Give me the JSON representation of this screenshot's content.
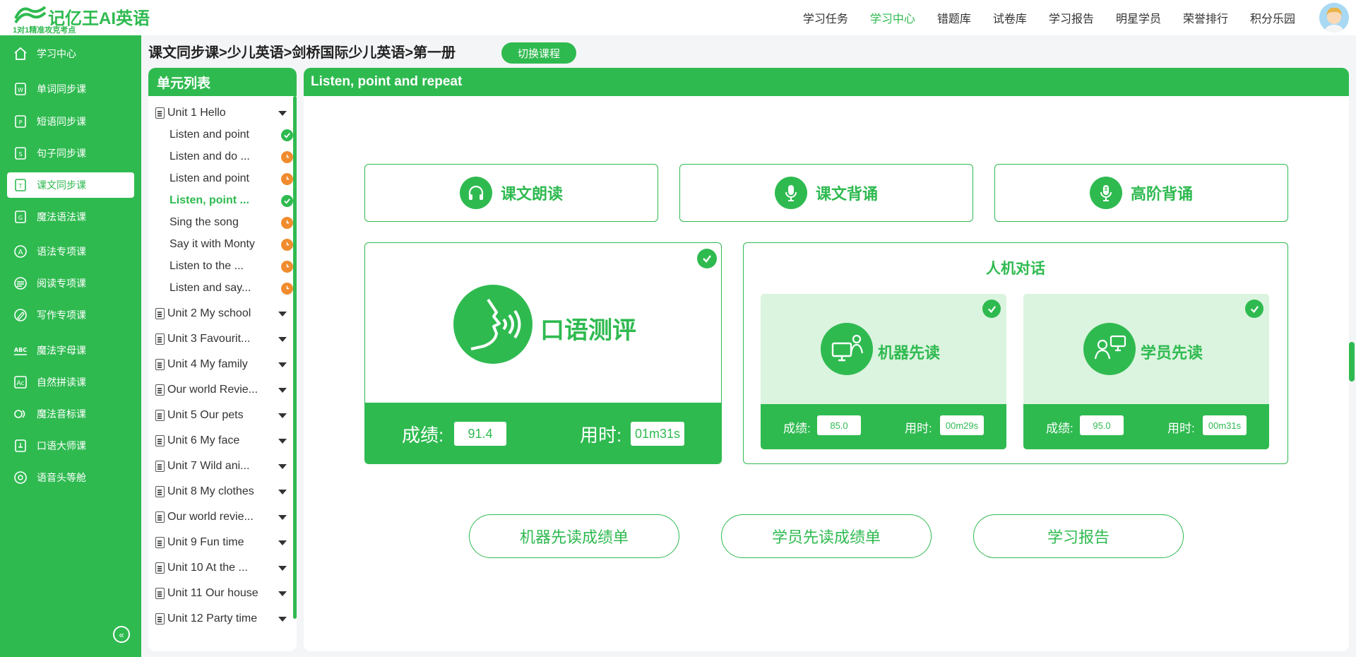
{
  "logo": {
    "name": "记亿王AI英语",
    "slogan": "1对1精准攻克考点"
  },
  "nav": [
    "学习任务",
    "学习中心",
    "错题库",
    "试卷库",
    "学习报告",
    "明星学员",
    "荣誉排行",
    "积分乐园"
  ],
  "nav_active": "学习中心",
  "sidebar": {
    "items": [
      {
        "label": "学习中心",
        "icon": "home-icon"
      },
      {
        "label": "单词同步课",
        "icon": "word-book-icon"
      },
      {
        "label": "短语同步课",
        "icon": "phrase-book-icon"
      },
      {
        "label": "句子同步课",
        "icon": "sentence-book-icon"
      },
      {
        "label": "课文同步课",
        "icon": "text-book-icon"
      },
      {
        "label": "魔法语法课",
        "icon": "grammar-book-icon"
      },
      {
        "label": "语法专项课",
        "icon": "grammar-special-icon"
      },
      {
        "label": "阅读专项课",
        "icon": "reading-icon"
      },
      {
        "label": "写作专项课",
        "icon": "writing-icon"
      },
      {
        "label": "魔法字母课",
        "icon": "abc-icon"
      },
      {
        "label": "自然拼读课",
        "icon": "phonics-icon"
      },
      {
        "label": "魔法音标课",
        "icon": "phonetic-icon"
      },
      {
        "label": "口语大师课",
        "icon": "speaking-icon"
      },
      {
        "label": "语音头等舱",
        "icon": "voice-cabin-icon"
      }
    ],
    "active_index": 4
  },
  "breadcrumb": "课文同步课>少儿英语>剑桥国际少儿英语>第一册",
  "switch_course_label": "切换课程",
  "unit_panel": {
    "title": "单元列表",
    "units": [
      {
        "label": "Unit 1 Hello",
        "expanded": true,
        "lessons": [
          {
            "label": "Listen and point",
            "status": "done"
          },
          {
            "label": "Listen and do ...",
            "status": "pending"
          },
          {
            "label": "Listen and point",
            "status": "pending"
          },
          {
            "label": "Listen, point ...",
            "status": "done",
            "active": true
          },
          {
            "label": "Sing the song",
            "status": "pending"
          },
          {
            "label": "Say it with Monty",
            "status": "pending"
          },
          {
            "label": "Listen to the ...",
            "status": "pending"
          },
          {
            "label": "Listen and say...",
            "status": "pending"
          }
        ]
      },
      {
        "label": "Unit 2 My school"
      },
      {
        "label": "Unit 3 Favourit..."
      },
      {
        "label": "Unit 4 My family"
      },
      {
        "label": "Our world Revie..."
      },
      {
        "label": "Unit 5 Our pets"
      },
      {
        "label": "Unit 6 My face"
      },
      {
        "label": "Unit 7 Wild ani..."
      },
      {
        "label": "Unit 8 My clothes"
      },
      {
        "label": "Our world revie..."
      },
      {
        "label": "Unit 9 Fun time"
      },
      {
        "label": "Unit 10 At the ..."
      },
      {
        "label": "Unit 11 Our house"
      },
      {
        "label": "Unit 12 Party time"
      }
    ]
  },
  "main": {
    "title": "Listen, point and repeat",
    "modes": [
      {
        "label": "课文朗读",
        "icon": "headphones-icon"
      },
      {
        "label": "课文背诵",
        "icon": "microphone-icon"
      },
      {
        "label": "高阶背诵",
        "icon": "microphone-advanced-icon"
      }
    ],
    "oral": {
      "label": "口语测评",
      "score_label": "成绩:",
      "score": "91.4",
      "time_label": "用时:",
      "time": "01m31s"
    },
    "dialog": {
      "title": "人机对话",
      "cards": [
        {
          "label": "机器先读",
          "score_label": "成绩:",
          "score": "85.0",
          "time_label": "用时:",
          "time": "00m29s"
        },
        {
          "label": "学员先读",
          "score_label": "成绩:",
          "score": "95.0",
          "time_label": "用时:",
          "time": "00m31s"
        }
      ]
    },
    "reports": [
      "机器先读成绩单",
      "学员先读成绩单",
      "学习报告"
    ]
  },
  "colors": {
    "primary": "#2fba50",
    "pending": "#f08c2e",
    "light": "#dbf4df"
  }
}
